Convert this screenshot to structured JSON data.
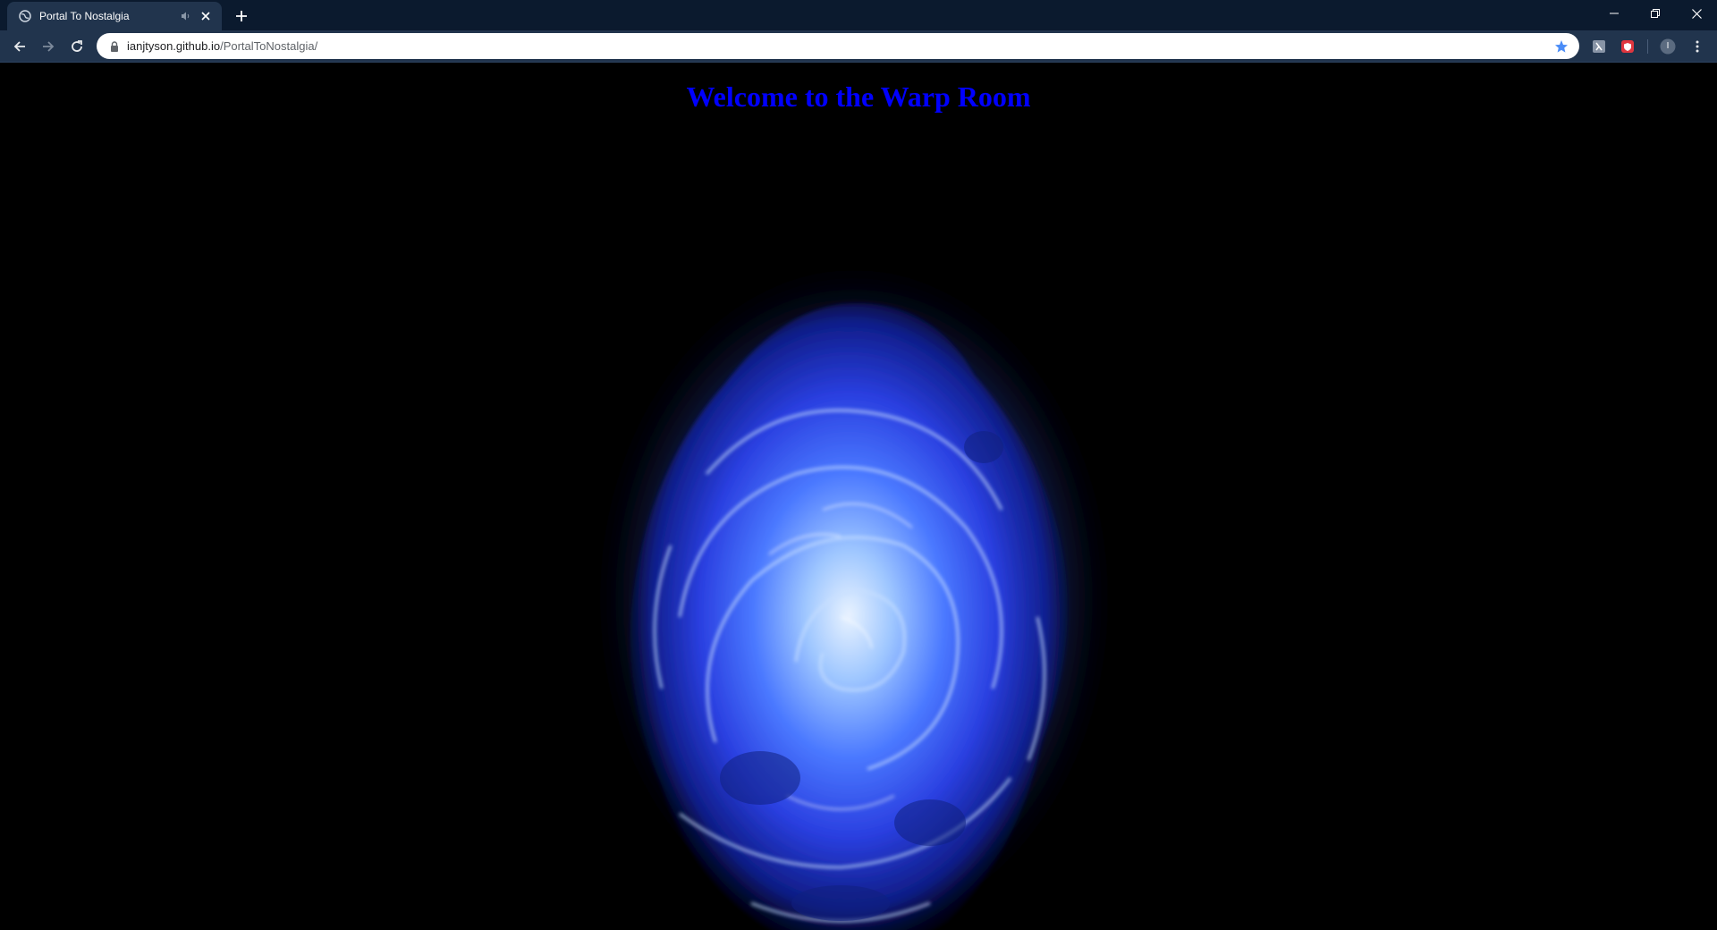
{
  "tab": {
    "title": "Portal To Nostalgia",
    "favicon_icon": "globe-icon",
    "audio_icon": "speaker-icon",
    "close_icon": "close-icon"
  },
  "new_tab_icon": "plus-icon",
  "window_controls": [
    "minimize-icon",
    "restore-icon",
    "close-icon"
  ],
  "toolbar": {
    "back_icon": "back-arrow-icon",
    "forward_icon": "forward-arrow-icon",
    "reload_icon": "reload-icon",
    "lock_icon": "lock-icon",
    "url_host": "ianjtyson.github.io",
    "url_path": "/PortalToNostalgia/",
    "bookmark_icon": "star-icon",
    "extensions": [
      "extension-icon",
      "shield-extension-icon"
    ],
    "profile_initial": "I",
    "menu_icon": "kebab-menu-icon"
  },
  "page": {
    "heading": "Welcome to the Warp Room",
    "heading_color": "#0000ff",
    "background_color": "#000000"
  },
  "colors": {
    "tabstrip": "#0b1a2e",
    "toolbar": "#21344d",
    "bookmark_star": "#4a8cf7",
    "shield_extension": "#e0363f"
  }
}
